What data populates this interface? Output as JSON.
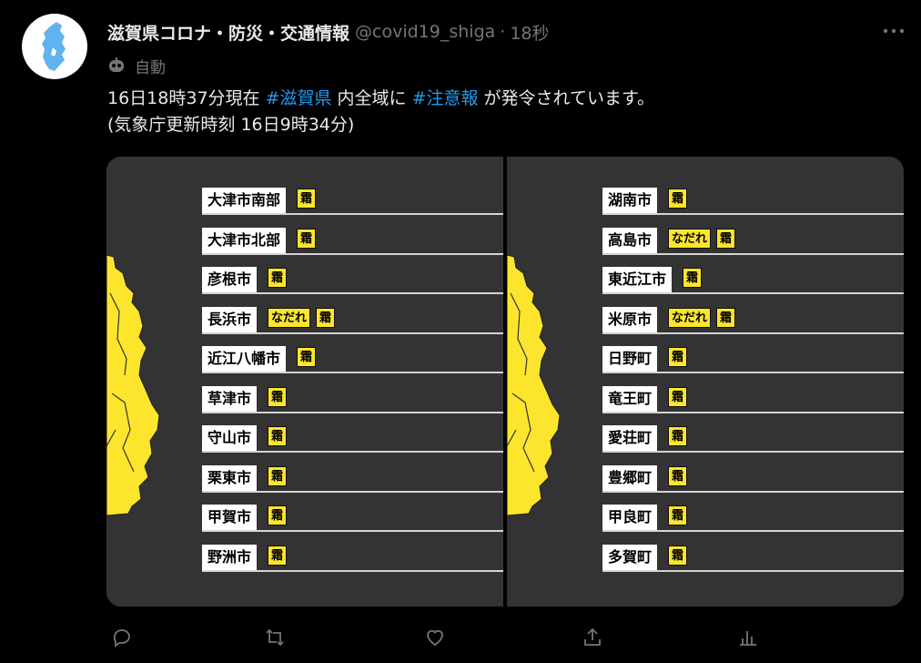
{
  "tweet": {
    "display_name": "滋賀県コロナ・防災・交通情報",
    "handle": "@covid19_shiga",
    "separator": "·",
    "time": "18秒",
    "auto_label": "自動",
    "text_parts": [
      "16日18時37分現在 ",
      "#滋賀県",
      " 内全域に ",
      "#注意報",
      " が発令されています。"
    ],
    "text_line2": "(気象庁更新時刻 16日9時34分)"
  },
  "media": {
    "left": [
      {
        "city": "大津市南部",
        "tags": [
          "霜"
        ]
      },
      {
        "city": "大津市北部",
        "tags": [
          "霜"
        ]
      },
      {
        "city": "彦根市",
        "tags": [
          "霜"
        ]
      },
      {
        "city": "長浜市",
        "tags": [
          "なだれ",
          "霜"
        ]
      },
      {
        "city": "近江八幡市",
        "tags": [
          "霜"
        ]
      },
      {
        "city": "草津市",
        "tags": [
          "霜"
        ]
      },
      {
        "city": "守山市",
        "tags": [
          "霜"
        ]
      },
      {
        "city": "栗東市",
        "tags": [
          "霜"
        ]
      },
      {
        "city": "甲賀市",
        "tags": [
          "霜"
        ]
      },
      {
        "city": "野洲市",
        "tags": [
          "霜"
        ]
      }
    ],
    "right": [
      {
        "city": "湖南市",
        "tags": [
          "霜"
        ]
      },
      {
        "city": "高島市",
        "tags": [
          "なだれ",
          "霜"
        ]
      },
      {
        "city": "東近江市",
        "tags": [
          "霜"
        ]
      },
      {
        "city": "米原市",
        "tags": [
          "なだれ",
          "霜"
        ]
      },
      {
        "city": "日野町",
        "tags": [
          "霜"
        ]
      },
      {
        "city": "竜王町",
        "tags": [
          "霜"
        ]
      },
      {
        "city": "愛荘町",
        "tags": [
          "霜"
        ]
      },
      {
        "city": "豊郷町",
        "tags": [
          "霜"
        ]
      },
      {
        "city": "甲良町",
        "tags": [
          "霜"
        ]
      },
      {
        "city": "多賀町",
        "tags": [
          "霜"
        ]
      }
    ]
  },
  "icons": {
    "avatar": "shiga-lake-icon",
    "more": "more-dots-icon",
    "auto": "bot-icon",
    "actions": [
      "reply-icon",
      "retweet-icon",
      "like-icon",
      "share-icon",
      "analytics-icon"
    ]
  },
  "colors": {
    "accent": "#1d9bf0",
    "warning": "#fde52d",
    "panel": "#333333",
    "muted": "#71767b"
  }
}
